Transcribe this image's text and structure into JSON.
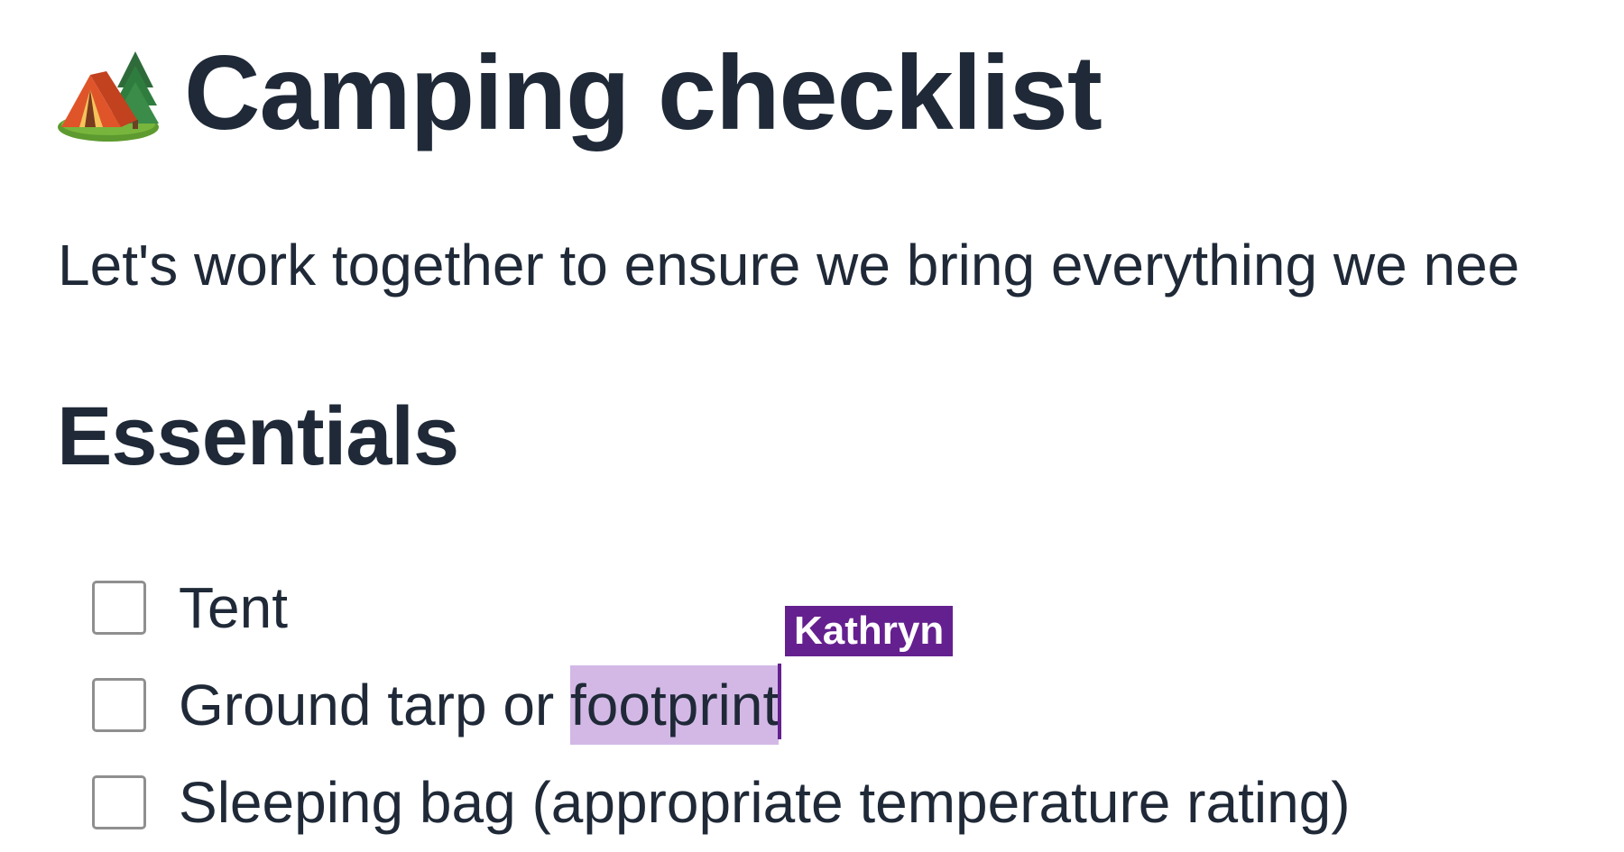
{
  "document": {
    "title": "Camping checklist",
    "title_icon": "camping-tent-icon",
    "intro": "Let's work together to ensure we bring everything we nee"
  },
  "section": {
    "heading": "Essentials",
    "items": [
      {
        "text": "Tent",
        "checked": false
      },
      {
        "text_before": "Ground tarp or ",
        "text_selected": "footprint",
        "checked": false
      },
      {
        "text": "Sleeping bag (appropriate temperature rating)",
        "checked": false
      }
    ]
  },
  "collaborator": {
    "name": "Kathryn",
    "color": "#65208f",
    "selection_color": "#d3b8e6"
  },
  "colors": {
    "text": "#1f2937",
    "checkbox_border": "#8f8f8f"
  }
}
